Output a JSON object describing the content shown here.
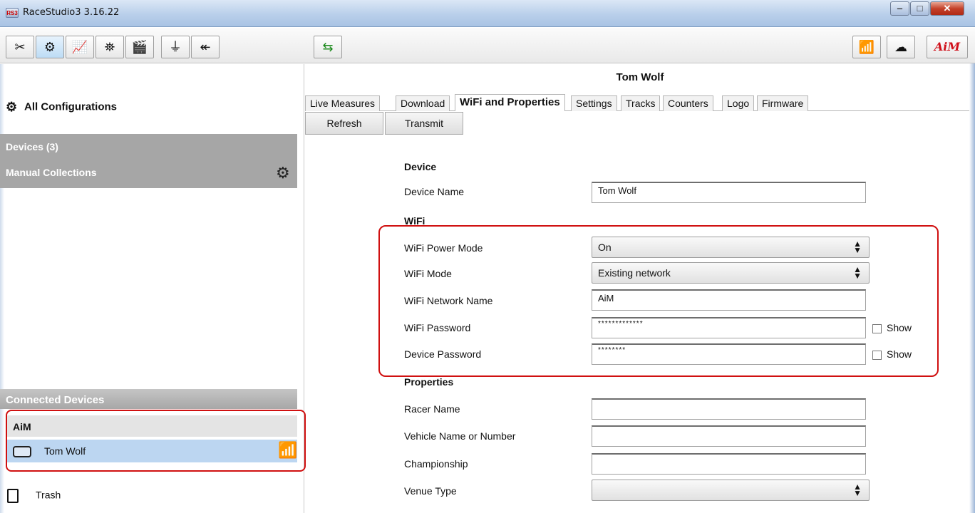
{
  "window": {
    "app_icon": "RS3",
    "title": "RaceStudio3 3.16.22",
    "min_label": "‒",
    "max_label": "□",
    "close_label": "✕"
  },
  "toolbar": {
    "buttons": [
      {
        "name": "settings-tools-icon",
        "glyph": "✂"
      },
      {
        "name": "configurations-icon",
        "glyph": "⚙"
      },
      {
        "name": "analysis-icon",
        "glyph": "📈"
      },
      {
        "name": "tracks-icon",
        "glyph": "⛯"
      },
      {
        "name": "video-icon",
        "glyph": "🎬"
      },
      {
        "name": "sensor-icon",
        "glyph": "⏚"
      },
      {
        "name": "add-device-icon",
        "glyph": "↞"
      },
      {
        "name": "transfer-icon",
        "glyph": "⇆"
      },
      {
        "name": "wifi-icon",
        "glyph": "📶"
      },
      {
        "name": "cloud-download-icon",
        "glyph": "☁"
      }
    ],
    "logo": "AiM"
  },
  "sidebar": {
    "all_configurations": "All Configurations",
    "devices": "Devices  (3)",
    "manual_collections": "Manual Collections",
    "connected_devices": "Connected Devices",
    "group": "AiM",
    "device": "Tom Wolf",
    "trash": "Trash"
  },
  "main": {
    "device_title": "Tom Wolf",
    "tabs": [
      "Live Measures",
      "Download",
      "WiFi and Properties",
      "Settings",
      "Tracks",
      "Counters",
      "Logo",
      "Firmware"
    ],
    "active_tab": "WiFi and Properties",
    "refresh_label": "Refresh",
    "transmit_label": "Transmit",
    "device_section": "Device",
    "device_name_label": "Device Name",
    "device_name_value": "Tom Wolf",
    "wifi_section": "WiFi",
    "wifi_power_mode_label": "WiFi Power Mode",
    "wifi_power_mode_value": "On",
    "wifi_mode_label": "WiFi Mode",
    "wifi_mode_value": "Existing network",
    "wifi_network_name_label": "WiFi Network Name",
    "wifi_network_name_value": "AiM",
    "wifi_password_label": "WiFi Password",
    "wifi_password_value": "*************",
    "device_password_label": "Device Password",
    "device_password_value": "********",
    "show_label": "Show",
    "properties_section": "Properties",
    "racer_name_label": "Racer Name",
    "racer_name_value": "",
    "vehicle_label": "Vehicle Name or Number",
    "vehicle_value": "",
    "championship_label": "Championship",
    "championship_value": "",
    "venue_type_label": "Venue Type",
    "venue_type_value": ""
  },
  "colors": {
    "highlight_border": "#d01010",
    "selected_row": "#bcd6f1",
    "section_header": "#a6a6a6"
  }
}
